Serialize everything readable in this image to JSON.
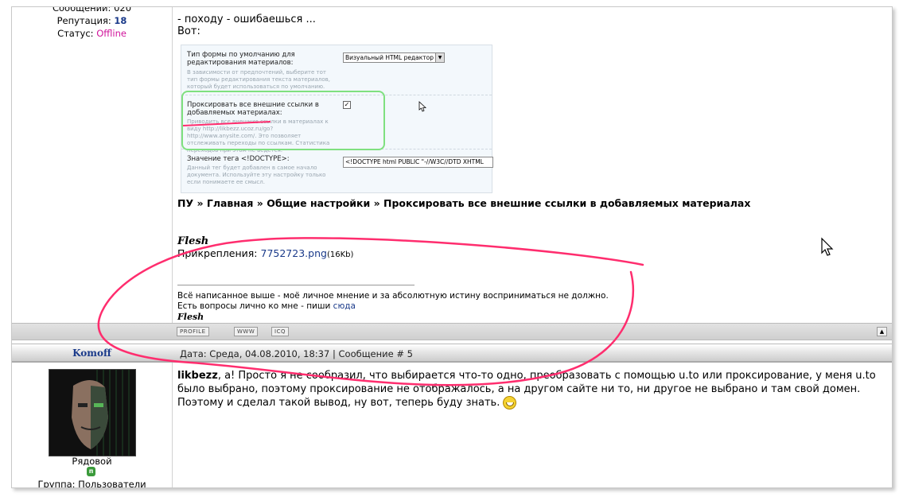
{
  "user1": {
    "messages_label": "Сообщений: 020",
    "reputation_label": "Репутация:",
    "reputation_value": "18",
    "status_label": "Статус:",
    "status_value": "Offline"
  },
  "post1": {
    "line1": "- походу - ошибаешься ...",
    "line2": "Вот:",
    "screenshot": {
      "row1_label": "Тип формы по умолчанию для редактирования материалов:",
      "row1_hint": "В зависимости от предпочтений, выберите тот тип формы редактирования текста материалов, который будет использоваться по умолчанию.",
      "row1_select": "Визуальный HTML редактор",
      "row2_label": "Проксировать все внешние ссылки в добавляемых материалах:",
      "row2_hint": "Приводить все внешние ссылки в материалах к виду http://likbezz.ucoz.ru/go?http://www.anysite.com/. Это позволяет отслеживать переходы по ссылкам. Статистика переходов при этом не ведется.",
      "row3_label": "Значение тега <!DOCTYPE>:",
      "row3_hint": "Данный тег будет добавлен в самое начало документа. Используйте эту настройку только если понимаете ее смысл.",
      "row3_input": "<!DOCTYPE html PUBLIC \"-//W3C//DTD XHTML"
    },
    "breadcrumb": "ПУ » Главная » Общие настройки » Проксировать все внешние ссылки в добавляемых материалах",
    "sig_name": "Flesh",
    "attach_label": "Прикрепления:",
    "attach_file": "7752723.png",
    "attach_size": "(16Kb)",
    "sig_line1": "Всё написанное выше - моё личное мнение и за абсолютную истину восприниматься не должно.",
    "sig_line2": "Есть вопросы лично ко мне - пиши",
    "sig_link": "сюда",
    "sig_name2": "Flesh",
    "buttons": [
      "PROFILE",
      "WWW",
      "ICQ"
    ]
  },
  "post2": {
    "username": "Komoff",
    "meta": "Дата: Среда, 04.08.2010, 18:37 | Сообщение # 5",
    "rank": "Рядовой",
    "group": "Группа: Пользователи",
    "mention": "likbezz",
    "text": ", а! Просто я не сообразил, что выбирается что-то одно, преобразовать с помощью u.to или проксирование, у меня u.to было выбрано, поэтому проксирование не отображалось, а на другом сайте ни то, ни другое не выбрано и там свой домен. Поэтому и сделал такой вывод, ну вот, теперь буду знать."
  },
  "colors": {
    "annotation": "#ff2d6e",
    "link": "#1a3a8a",
    "offline": "#d0149b"
  },
  "icons": [
    "mouse-cursor-icon",
    "smiley-icon",
    "scroll-up-icon",
    "rank-badge-icon",
    "checkbox-icon",
    "dropdown-arrow-icon"
  ]
}
